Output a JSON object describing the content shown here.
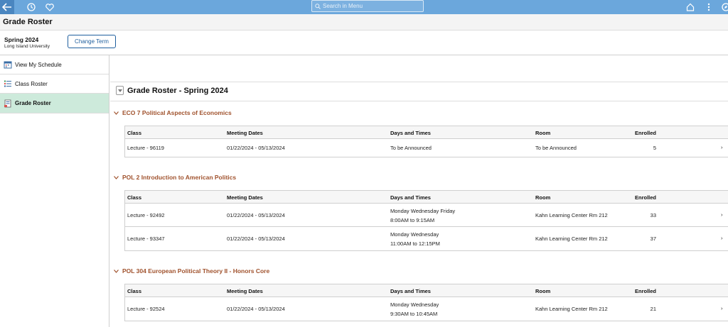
{
  "nav": {
    "search_placeholder": "Search in Menu"
  },
  "page": {
    "title": "Grade Roster"
  },
  "term": {
    "name": "Spring 2024",
    "institution": "Long Island University",
    "change_label": "Change Term"
  },
  "sidebar": {
    "items": [
      {
        "label": "View My Schedule",
        "icon": "calendar-icon"
      },
      {
        "label": "Class Roster",
        "icon": "list-icon"
      },
      {
        "label": "Grade Roster",
        "icon": "gradebook-icon",
        "active": true
      }
    ]
  },
  "roster": {
    "title": "Grade Roster - Spring 2024",
    "columns": {
      "class": "Class",
      "dates": "Meeting Dates",
      "days": "Days and Times",
      "room": "Room",
      "enrolled": "Enrolled"
    },
    "courses": [
      {
        "name": "ECO 7 Political Aspects of Economics",
        "sections": [
          {
            "class": "Lecture - 96119",
            "dates": "01/22/2024 - 05/13/2024",
            "days": "To be Announced",
            "times": "",
            "room": "To be Announced",
            "enrolled": "5"
          }
        ]
      },
      {
        "name": "POL 2 Introduction to American Politics",
        "sections": [
          {
            "class": "Lecture - 92492",
            "dates": "01/22/2024 - 05/13/2024",
            "days": "Monday Wednesday Friday",
            "times": "8:00AM to 9:15AM",
            "room": "Kahn Learning Center Rm 212",
            "enrolled": "33"
          },
          {
            "class": "Lecture - 93347",
            "dates": "01/22/2024 - 05/13/2024",
            "days": "Monday Wednesday",
            "times": "11:00AM to 12:15PM",
            "room": "Kahn Learning Center Rm 212",
            "enrolled": "37"
          }
        ]
      },
      {
        "name": "POL 304 European Political Theory II - Honors Core",
        "sections": [
          {
            "class": "Lecture - 92524",
            "dates": "01/22/2024 - 05/13/2024",
            "days": "Monday Wednesday",
            "times": "9:30AM to 10:45AM",
            "room": "Kahn Learning Center Rm 212",
            "enrolled": "21"
          }
        ]
      }
    ]
  },
  "colors": {
    "nav_bar": "#6ba7dc",
    "course_title": "#a0522d",
    "active_sidebar": "#cdeadb",
    "link": "#1f5f9e"
  }
}
